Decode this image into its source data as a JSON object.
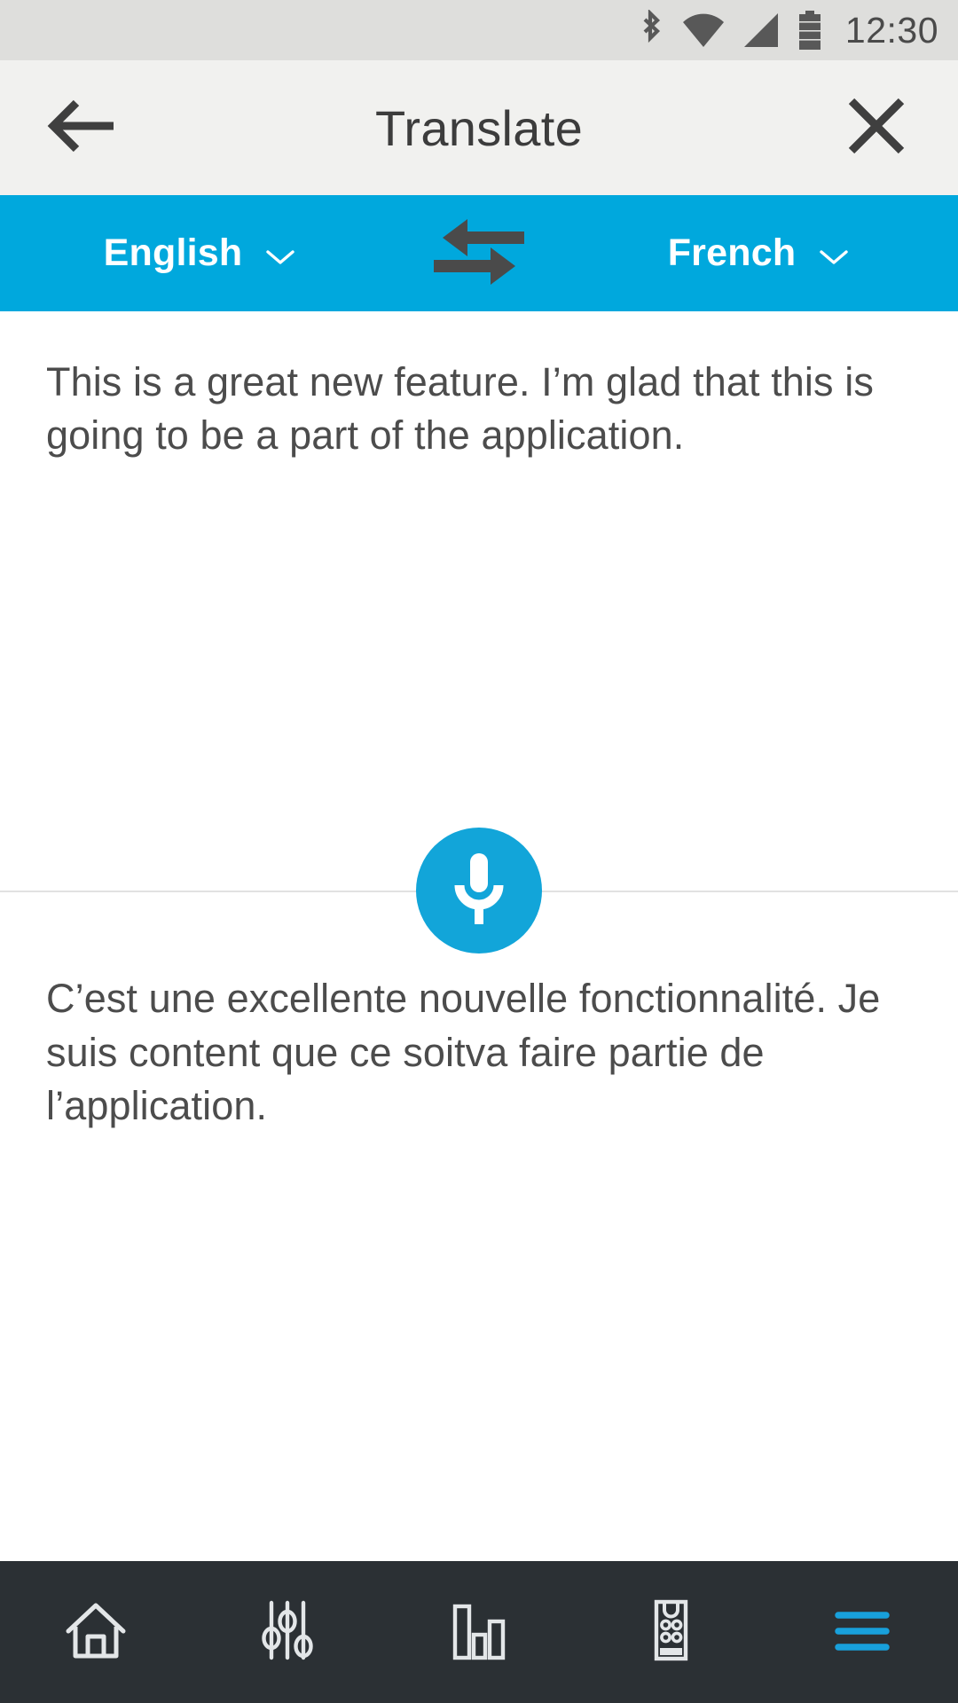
{
  "statusbar": {
    "time": "12:30",
    "icons": [
      {
        "name": "bluetooth-icon"
      },
      {
        "name": "wifi-icon"
      },
      {
        "name": "cellular-signal-icon"
      },
      {
        "name": "battery-icon"
      }
    ]
  },
  "header": {
    "title": "Translate",
    "back_icon": "back-arrow-icon",
    "close_icon": "close-icon"
  },
  "language_bar": {
    "source_language": "English",
    "target_language": "French",
    "swap_icon": "swap-arrows-icon",
    "dropdown_icon": "chevron-down-icon",
    "background_color": "#00a8dd"
  },
  "translation": {
    "source_text": "This is a great new feature. I’m glad that this is going to be a part of the application.",
    "target_text": "C’est une excellente nouvelle fonctionnalité. Je suis content que ce soitva faire partie de l’application."
  },
  "mic": {
    "icon": "microphone-icon",
    "color": "#12a5d9"
  },
  "bottom_nav": {
    "background_color": "#2b3034",
    "active_color": "#18a0db",
    "items": [
      {
        "name": "nav-home",
        "icon": "home-icon",
        "active": false
      },
      {
        "name": "nav-settings",
        "icon": "sliders-icon",
        "active": false
      },
      {
        "name": "nav-stats",
        "icon": "bar-chart-icon",
        "active": false
      },
      {
        "name": "nav-remote",
        "icon": "remote-control-icon",
        "active": false
      },
      {
        "name": "nav-menu",
        "icon": "hamburger-menu-icon",
        "active": true
      }
    ]
  }
}
